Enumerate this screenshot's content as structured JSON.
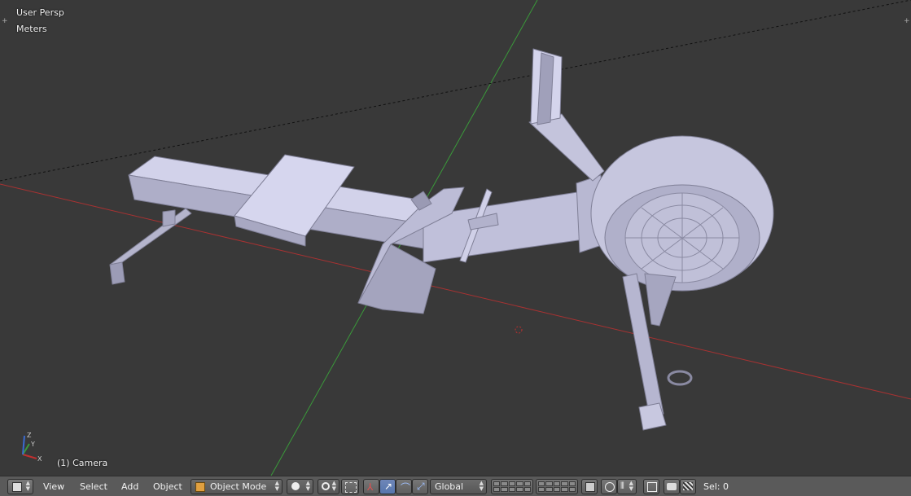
{
  "viewport": {
    "view_name": "User Persp",
    "units": "Meters",
    "object_info": "(1) Camera",
    "axis_colors": {
      "x": "#b03030",
      "y": "#3a9a3a",
      "z": "#3a6ad0"
    }
  },
  "header": {
    "editor_type_icon": "cube-editor-icon",
    "menus": {
      "view": "View",
      "select": "Select",
      "add": "Add",
      "object": "Object"
    },
    "mode": "Object Mode",
    "orientation": "Global",
    "status": "Sel: 0"
  },
  "colors": {
    "background": "#393939",
    "header": "#5a5a5a",
    "model": "#c9c9e0",
    "active_button": "#5676ad"
  }
}
